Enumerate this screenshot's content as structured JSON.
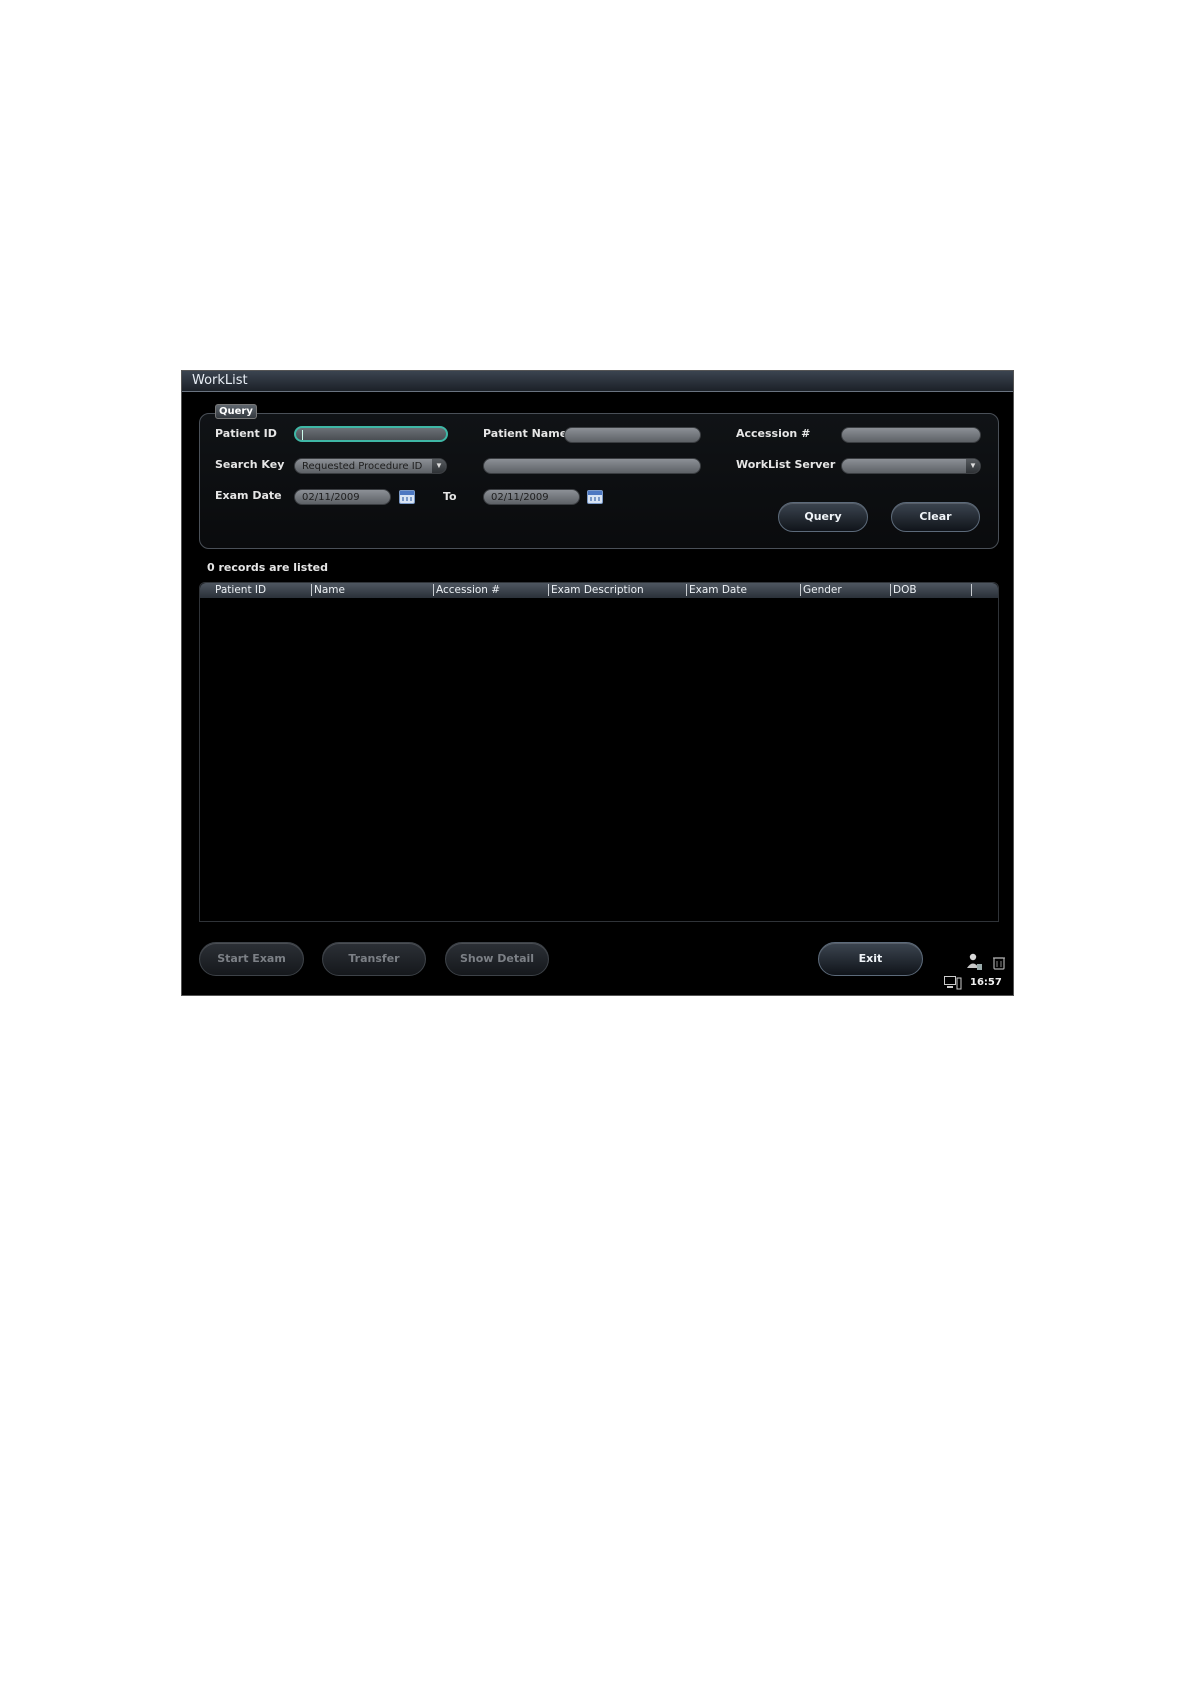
{
  "window": {
    "title": "WorkList"
  },
  "query": {
    "legend": "Query",
    "patient_id": {
      "label": "Patient ID",
      "value": ""
    },
    "patient_name": {
      "label": "Patient Name",
      "value": ""
    },
    "accession": {
      "label": "Accession #",
      "value": ""
    },
    "search_key": {
      "label": "Search Key",
      "selected": "Requested Procedure ID",
      "value": ""
    },
    "worklist_server": {
      "label": "WorkList Server",
      "selected": ""
    },
    "exam_date": {
      "label": "Exam Date",
      "from": "02/11/2009",
      "to_label": "To",
      "to": "02/11/2009"
    },
    "query_button": "Query",
    "clear_button": "Clear"
  },
  "records": {
    "count_text": "0 records are listed"
  },
  "table": {
    "columns": [
      "Patient ID",
      "Name",
      "Accession #",
      "Exam Description",
      "Exam Date",
      "Gender",
      "DOB"
    ],
    "rows": []
  },
  "footer": {
    "start_exam": "Start Exam",
    "transfer": "Transfer",
    "show_detail": "Show Detail",
    "exit": "Exit"
  },
  "status": {
    "time": "16:57",
    "icons": [
      "user-icon",
      "trash-icon",
      "monitor-icon"
    ]
  }
}
